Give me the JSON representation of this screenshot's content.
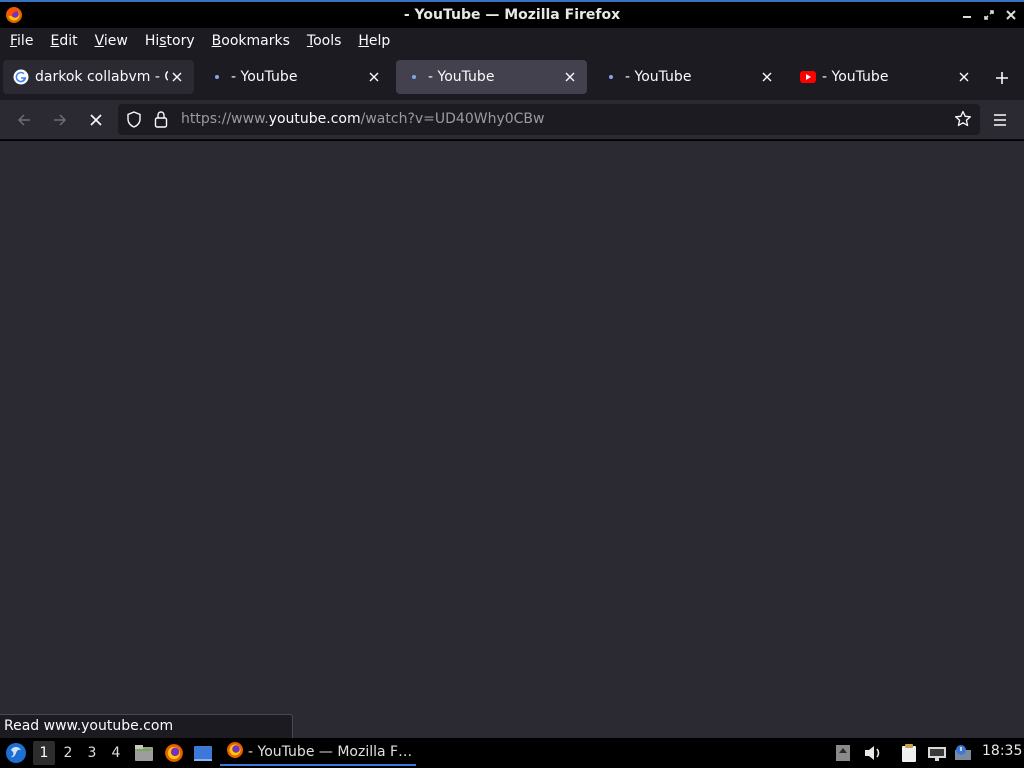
{
  "window": {
    "title": "- YouTube — Mozilla Firefox"
  },
  "menubar": {
    "items": [
      {
        "label": "File",
        "accel": "F",
        "rest": "ile"
      },
      {
        "label": "Edit",
        "accel": "E",
        "rest": "dit"
      },
      {
        "label": "View",
        "accel": "V",
        "rest": "iew"
      },
      {
        "label": "History",
        "pre": "Hi",
        "accel": "s",
        "rest": "tory"
      },
      {
        "label": "Bookmarks",
        "accel": "B",
        "rest": "ookmarks"
      },
      {
        "label": "Tools",
        "accel": "T",
        "rest": "ools"
      },
      {
        "label": "Help",
        "accel": "H",
        "rest": "elp"
      }
    ]
  },
  "tabs": [
    {
      "label": "darkok collabvm - G",
      "favicon": "google-icon"
    },
    {
      "label": "- YouTube",
      "favicon": "loading-dot-icon"
    },
    {
      "label": "- YouTube",
      "favicon": "loading-dot-icon",
      "selected": true
    },
    {
      "label": "- YouTube",
      "favicon": "loading-dot-icon"
    },
    {
      "label": "- YouTube",
      "favicon": "youtube-icon"
    }
  ],
  "urlbar": {
    "prefix": "https://www.",
    "host": "youtube.com",
    "suffix": "/watch?v=UD40Why0CBw"
  },
  "status": {
    "text": "Read www.youtube.com"
  },
  "taskbar": {
    "workspaces": [
      "1",
      "2",
      "3",
      "4"
    ],
    "active_workspace": "1",
    "task_label": "- YouTube — Mozilla F…",
    "clock": "18:35"
  },
  "colors": {
    "accent": "#3b78d8",
    "content_bg": "#2b2a33",
    "toolbar_bg": "#1c1b22",
    "youtube_red": "#ff0000"
  }
}
